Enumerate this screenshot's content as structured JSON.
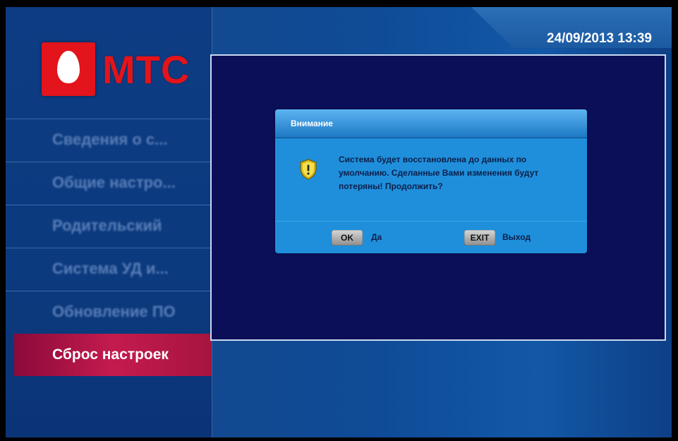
{
  "brand": {
    "logo_text": "МТС",
    "color": "#e3141b"
  },
  "datetime": "24/09/2013 13:39",
  "menu": {
    "items": [
      {
        "label": "Сведения о с..."
      },
      {
        "label": "Общие настро..."
      },
      {
        "label": "Родительский"
      },
      {
        "label": "Система УД и..."
      },
      {
        "label": "Обновление ПО"
      },
      {
        "label": "Сброс настроек",
        "active": true
      }
    ]
  },
  "dialog": {
    "title": "Внимание",
    "icon": "warning-shield-icon",
    "message": "Система будет восстановлена до данных по умолчанию. Сделанные Вами изменения будут потеряны! Продолжить?",
    "ok_key": "OK",
    "ok_label": "Да",
    "exit_key": "EXIT",
    "exit_label": "Выход"
  },
  "colors": {
    "active_item": "#c41b4e",
    "dialog_bg": "#1f8fdb",
    "preview_bg": "#0b0f58"
  }
}
